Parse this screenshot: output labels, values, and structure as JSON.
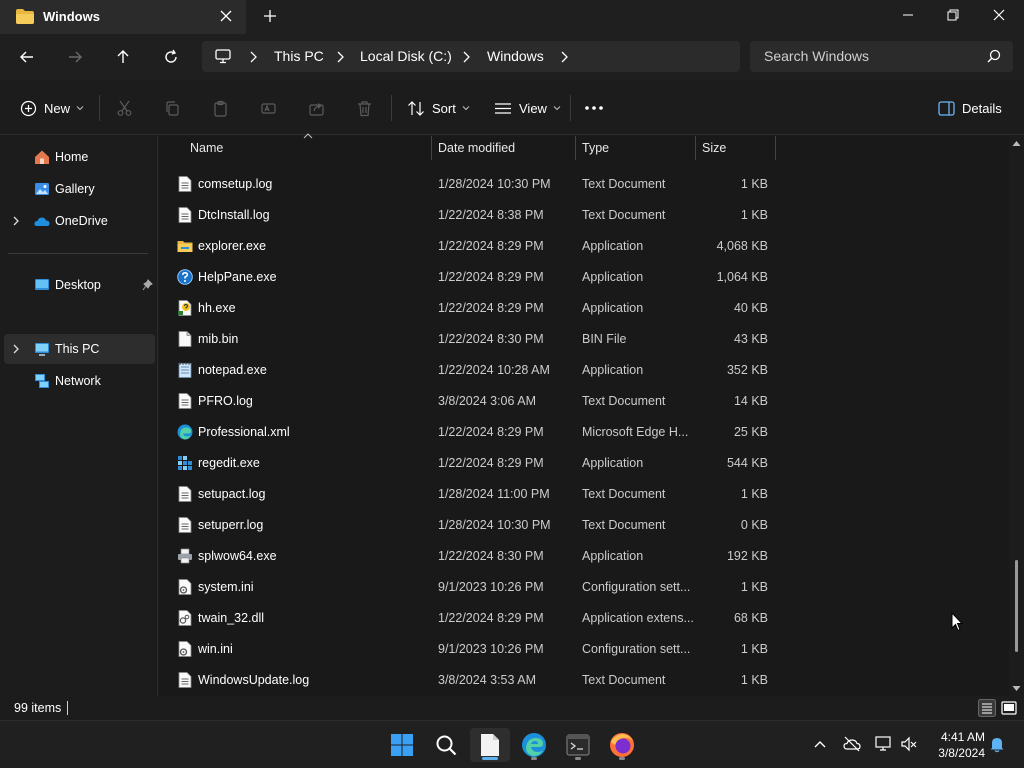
{
  "window": {
    "tab_title": "Windows",
    "minimize": "minimize",
    "maximize": "restore",
    "close": "close"
  },
  "address": {
    "crumbs": [
      "This PC",
      "Local Disk (C:)",
      "Windows"
    ],
    "search_placeholder": "Search Windows"
  },
  "toolbar": {
    "new_label": "New",
    "sort_label": "Sort",
    "view_label": "View",
    "details_label": "Details"
  },
  "nav": {
    "items": [
      {
        "label": "Home",
        "icon": "home-icon"
      },
      {
        "label": "Gallery",
        "icon": "gallery-icon"
      },
      {
        "label": "OneDrive",
        "icon": "onedrive-icon"
      },
      {
        "label": "Desktop",
        "icon": "desktop-icon"
      },
      {
        "label": "This PC",
        "icon": "pc-icon"
      },
      {
        "label": "Network",
        "icon": "network-icon"
      }
    ]
  },
  "columns": {
    "name": "Name",
    "date": "Date modified",
    "type": "Type",
    "size": "Size"
  },
  "files": [
    {
      "name": "comsetup.log",
      "date": "1/28/2024 10:30 PM",
      "type": "Text Document",
      "size": "1 KB",
      "icon": "text-file-icon"
    },
    {
      "name": "DtcInstall.log",
      "date": "1/22/2024 8:38 PM",
      "type": "Text Document",
      "size": "1 KB",
      "icon": "text-file-icon"
    },
    {
      "name": "explorer.exe",
      "date": "1/22/2024 8:29 PM",
      "type": "Application",
      "size": "4,068 KB",
      "icon": "explorer-app-icon"
    },
    {
      "name": "HelpPane.exe",
      "date": "1/22/2024 8:29 PM",
      "type": "Application",
      "size": "1,064 KB",
      "icon": "help-app-icon"
    },
    {
      "name": "hh.exe",
      "date": "1/22/2024 8:29 PM",
      "type": "Application",
      "size": "40 KB",
      "icon": "hh-app-icon"
    },
    {
      "name": "mib.bin",
      "date": "1/22/2024 8:30 PM",
      "type": "BIN File",
      "size": "43 KB",
      "icon": "blank-file-icon"
    },
    {
      "name": "notepad.exe",
      "date": "1/22/2024 10:28 AM",
      "type": "Application",
      "size": "352 KB",
      "icon": "notepad-app-icon"
    },
    {
      "name": "PFRO.log",
      "date": "3/8/2024 3:06 AM",
      "type": "Text Document",
      "size": "14 KB",
      "icon": "text-file-icon"
    },
    {
      "name": "Professional.xml",
      "date": "1/22/2024 8:29 PM",
      "type": "Microsoft Edge H...",
      "size": "25 KB",
      "icon": "edge-file-icon"
    },
    {
      "name": "regedit.exe",
      "date": "1/22/2024 8:29 PM",
      "type": "Application",
      "size": "544 KB",
      "icon": "regedit-app-icon"
    },
    {
      "name": "setupact.log",
      "date": "1/28/2024 11:00 PM",
      "type": "Text Document",
      "size": "1 KB",
      "icon": "text-file-icon"
    },
    {
      "name": "setuperr.log",
      "date": "1/28/2024 10:30 PM",
      "type": "Text Document",
      "size": "0 KB",
      "icon": "text-file-icon"
    },
    {
      "name": "splwow64.exe",
      "date": "1/22/2024 8:30 PM",
      "type": "Application",
      "size": "192 KB",
      "icon": "printer-app-icon"
    },
    {
      "name": "system.ini",
      "date": "9/1/2023 10:26 PM",
      "type": "Configuration sett...",
      "size": "1 KB",
      "icon": "config-file-icon"
    },
    {
      "name": "twain_32.dll",
      "date": "1/22/2024 8:29 PM",
      "type": "Application extens...",
      "size": "68 KB",
      "icon": "dll-file-icon"
    },
    {
      "name": "win.ini",
      "date": "9/1/2023 10:26 PM",
      "type": "Configuration sett...",
      "size": "1 KB",
      "icon": "config-file-icon"
    },
    {
      "name": "WindowsUpdate.log",
      "date": "3/8/2024 3:53 AM",
      "type": "Text Document",
      "size": "1 KB",
      "icon": "text-file-icon"
    }
  ],
  "status": {
    "item_count": "99 items"
  },
  "taskbar": {
    "apps": [
      "start-icon",
      "search-icon",
      "file-explorer-icon",
      "edge-icon",
      "terminal-icon",
      "firefox-icon"
    ],
    "time": "4:41 AM",
    "date": "3/8/2024"
  }
}
